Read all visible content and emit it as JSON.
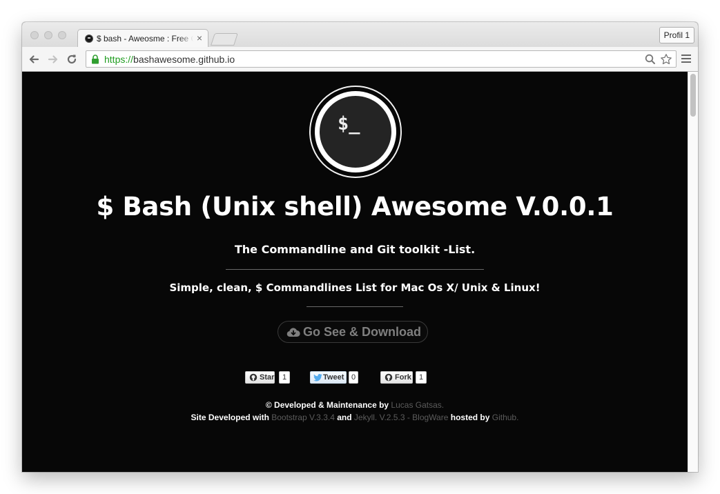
{
  "browser": {
    "tab_title": "$ bash - Aweosme : Free C",
    "tab_close": "×",
    "profile_label": "Profil 1",
    "url_scheme": "https://",
    "url_host": "bashawesome.github.io"
  },
  "page": {
    "logo_text": "$_",
    "title": "$ Bash (Unix shell) Awesome V.0.0.1",
    "subtitle": "The Commandline and Git toolkit -List.",
    "lead": "Simple, clean, $ Commandlines List for Mac Os X/ Unix & Linux!",
    "cta_label": "Go See & Download",
    "social": {
      "star_label": "Star",
      "star_count": "1",
      "tweet_label": "Tweet",
      "tweet_count": "0",
      "fork_label": "Fork",
      "fork_count": "1"
    },
    "footer": {
      "line1_prefix": "© Developed & Maintenance by ",
      "author": "Lucas Gatsas.",
      "line2_prefix": "Site Developed with ",
      "bootstrap": "Bootstrap V.3.3.4",
      "and": " and ",
      "jekyll": "Jekyll. V.2.5.3 - BlogWare",
      "hosted": " hosted by ",
      "github": "Github."
    }
  },
  "colors": {
    "page_bg": "#070707",
    "link": "#5c5c5c",
    "secure_green": "#1f9c1f"
  }
}
